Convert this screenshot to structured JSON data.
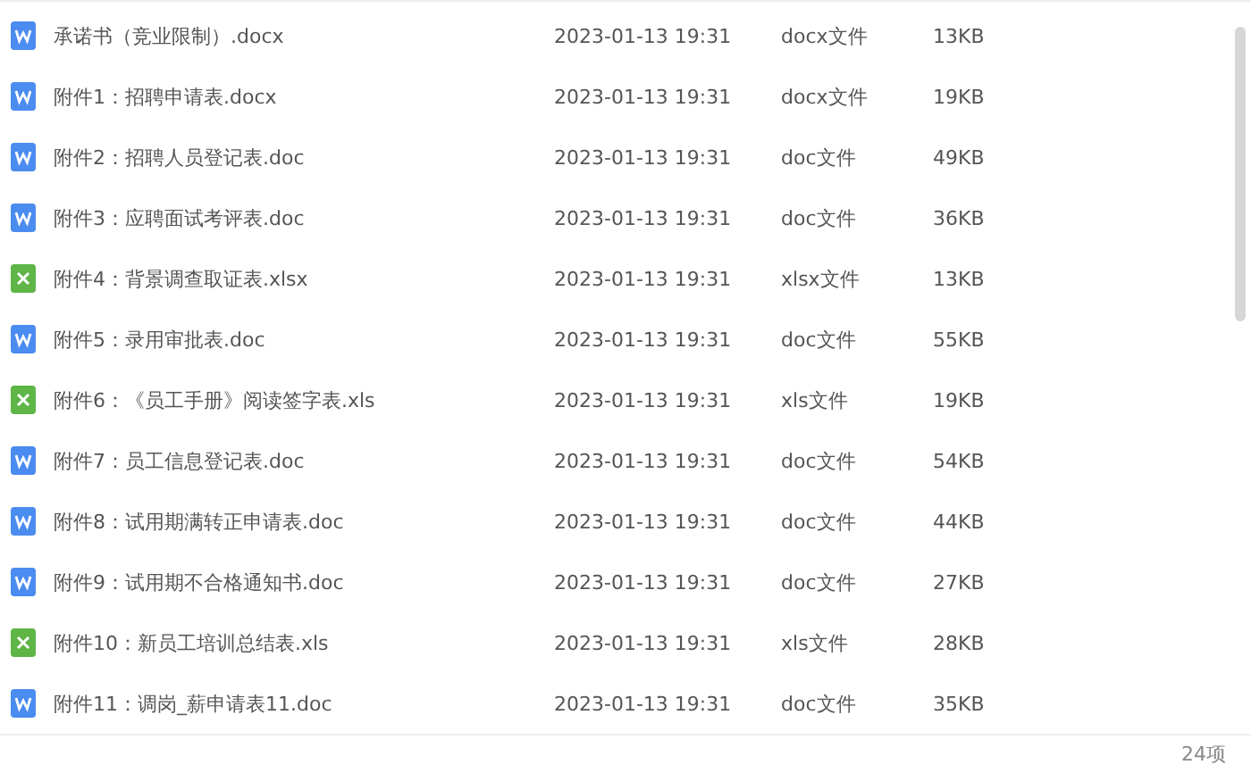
{
  "files": [
    {
      "kind": "word",
      "name": "承诺书（竞业限制）.docx",
      "modified": "2023-01-13 19:31",
      "type": "docx文件",
      "size": "13KB"
    },
    {
      "kind": "word",
      "name": "附件1：招聘申请表.docx",
      "modified": "2023-01-13 19:31",
      "type": "docx文件",
      "size": "19KB"
    },
    {
      "kind": "word",
      "name": "附件2：招聘人员登记表.doc",
      "modified": "2023-01-13 19:31",
      "type": "doc文件",
      "size": "49KB"
    },
    {
      "kind": "word",
      "name": "附件3：应聘面试考评表.doc",
      "modified": "2023-01-13 19:31",
      "type": "doc文件",
      "size": "36KB"
    },
    {
      "kind": "excel",
      "name": "附件4：背景调查取证表.xlsx",
      "modified": "2023-01-13 19:31",
      "type": "xlsx文件",
      "size": "13KB"
    },
    {
      "kind": "word",
      "name": "附件5：录用审批表.doc",
      "modified": "2023-01-13 19:31",
      "type": "doc文件",
      "size": "55KB"
    },
    {
      "kind": "excel",
      "name": "附件6：《员工手册》阅读签字表.xls",
      "modified": "2023-01-13 19:31",
      "type": "xls文件",
      "size": "19KB"
    },
    {
      "kind": "word",
      "name": "附件7：员工信息登记表.doc",
      "modified": "2023-01-13 19:31",
      "type": "doc文件",
      "size": "54KB"
    },
    {
      "kind": "word",
      "name": "附件8：试用期满转正申请表.doc",
      "modified": "2023-01-13 19:31",
      "type": "doc文件",
      "size": "44KB"
    },
    {
      "kind": "word",
      "name": "附件9：试用期不合格通知书.doc",
      "modified": "2023-01-13 19:31",
      "type": "doc文件",
      "size": "27KB"
    },
    {
      "kind": "excel",
      "name": "附件10：新员工培训总结表.xls",
      "modified": "2023-01-13 19:31",
      "type": "xls文件",
      "size": "28KB"
    },
    {
      "kind": "word",
      "name": "附件11：调岗_薪申请表11.doc",
      "modified": "2023-01-13 19:31",
      "type": "doc文件",
      "size": "35KB"
    }
  ],
  "status_bar": {
    "count": "24项"
  }
}
